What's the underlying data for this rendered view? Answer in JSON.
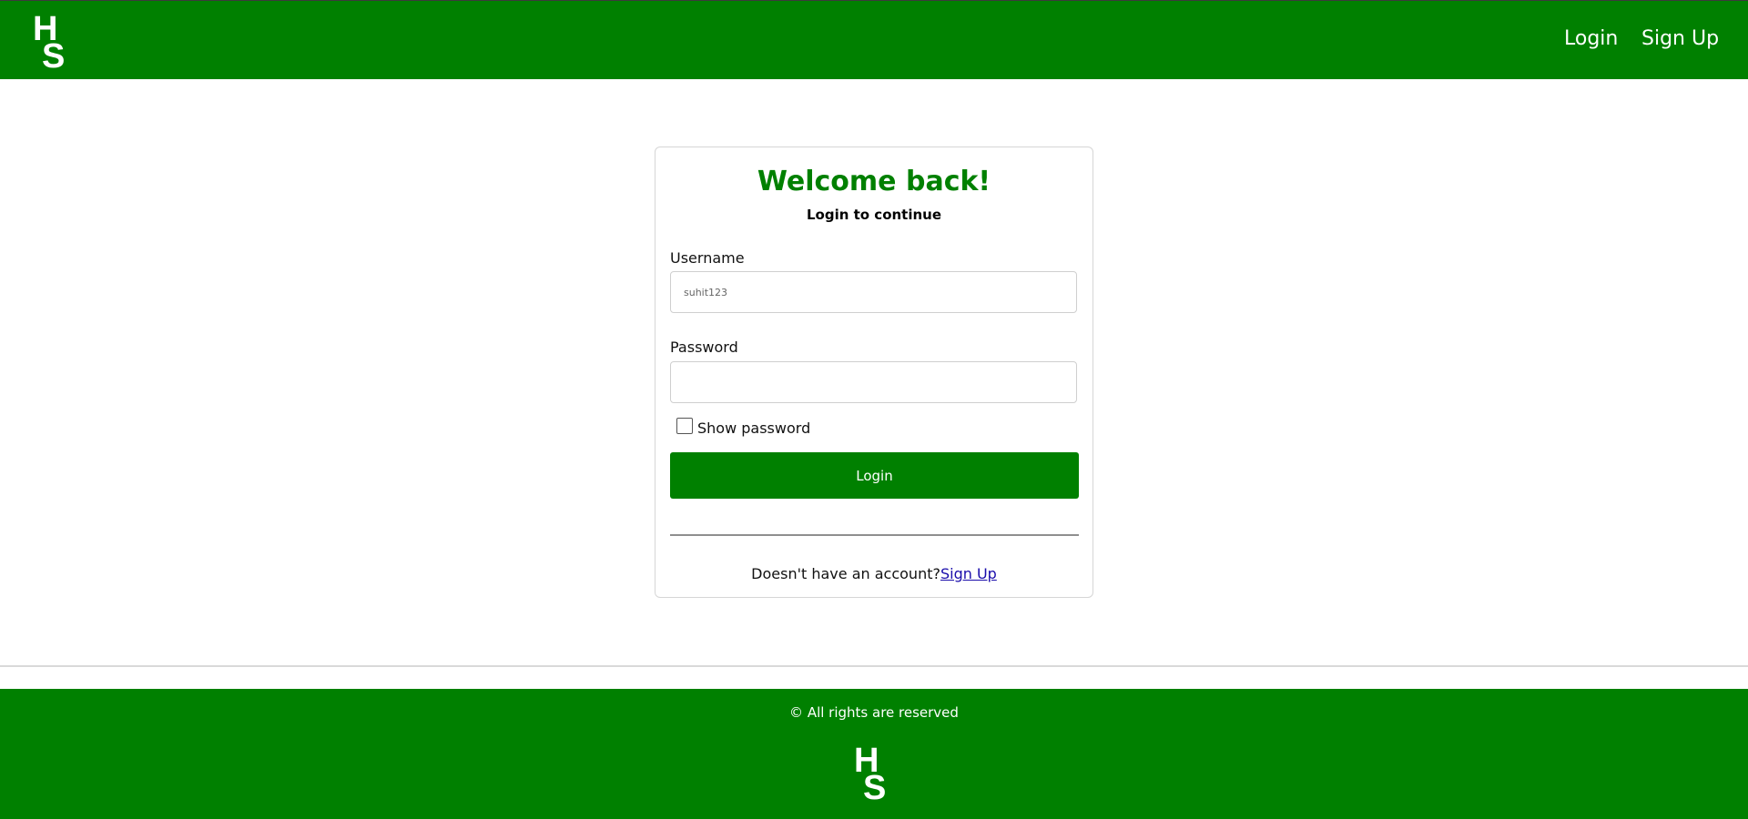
{
  "header": {
    "logo": "HS logo",
    "nav": {
      "login": "Login",
      "signup": "Sign Up"
    }
  },
  "card": {
    "title": "Welcome back!",
    "subtitle": "Login to continue",
    "username": {
      "label": "Username",
      "placeholder": "suhit123",
      "value": ""
    },
    "password": {
      "label": "Password",
      "value": ""
    },
    "show_password": {
      "label": "Show password",
      "checked": false
    },
    "login_button": "Login",
    "signup_prompt": "Doesn't have an account?",
    "signup_link": "Sign Up"
  },
  "footer": {
    "copyright": "© All rights are reserved",
    "logo": "HS logo"
  },
  "colors": {
    "brand_green": "#008000",
    "link_blue": "#1a0dab"
  }
}
